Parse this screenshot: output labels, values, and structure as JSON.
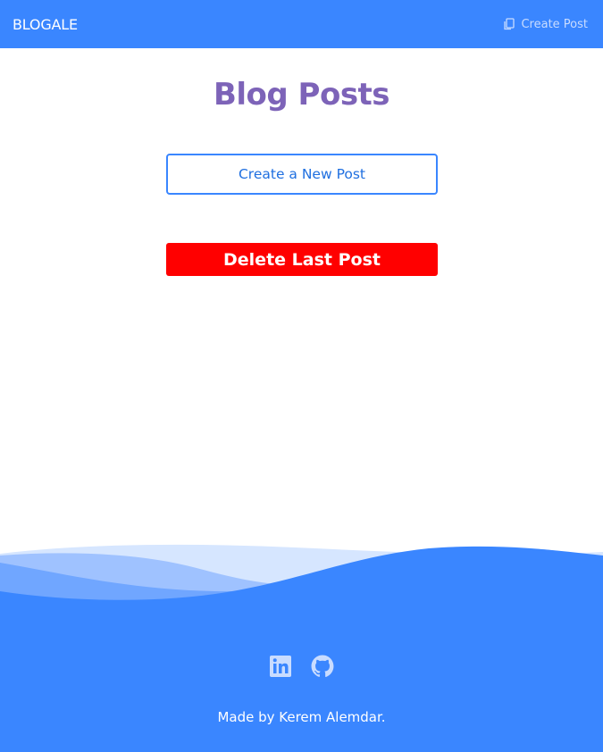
{
  "navbar": {
    "brand": "BLOGALE",
    "create_link_label": "Create Post",
    "create_link_icon": "copy-icon"
  },
  "main": {
    "title": "Blog Posts",
    "create_button_label": "Create a New Post",
    "delete_button_label": "Delete Last Post"
  },
  "footer": {
    "social_icons": [
      "linkedin-icon",
      "github-icon"
    ],
    "credit": "Made by Kerem Alemdar."
  },
  "colors": {
    "primary": "#3a86ff",
    "title": "#7d63b8",
    "danger": "#ff0000"
  }
}
